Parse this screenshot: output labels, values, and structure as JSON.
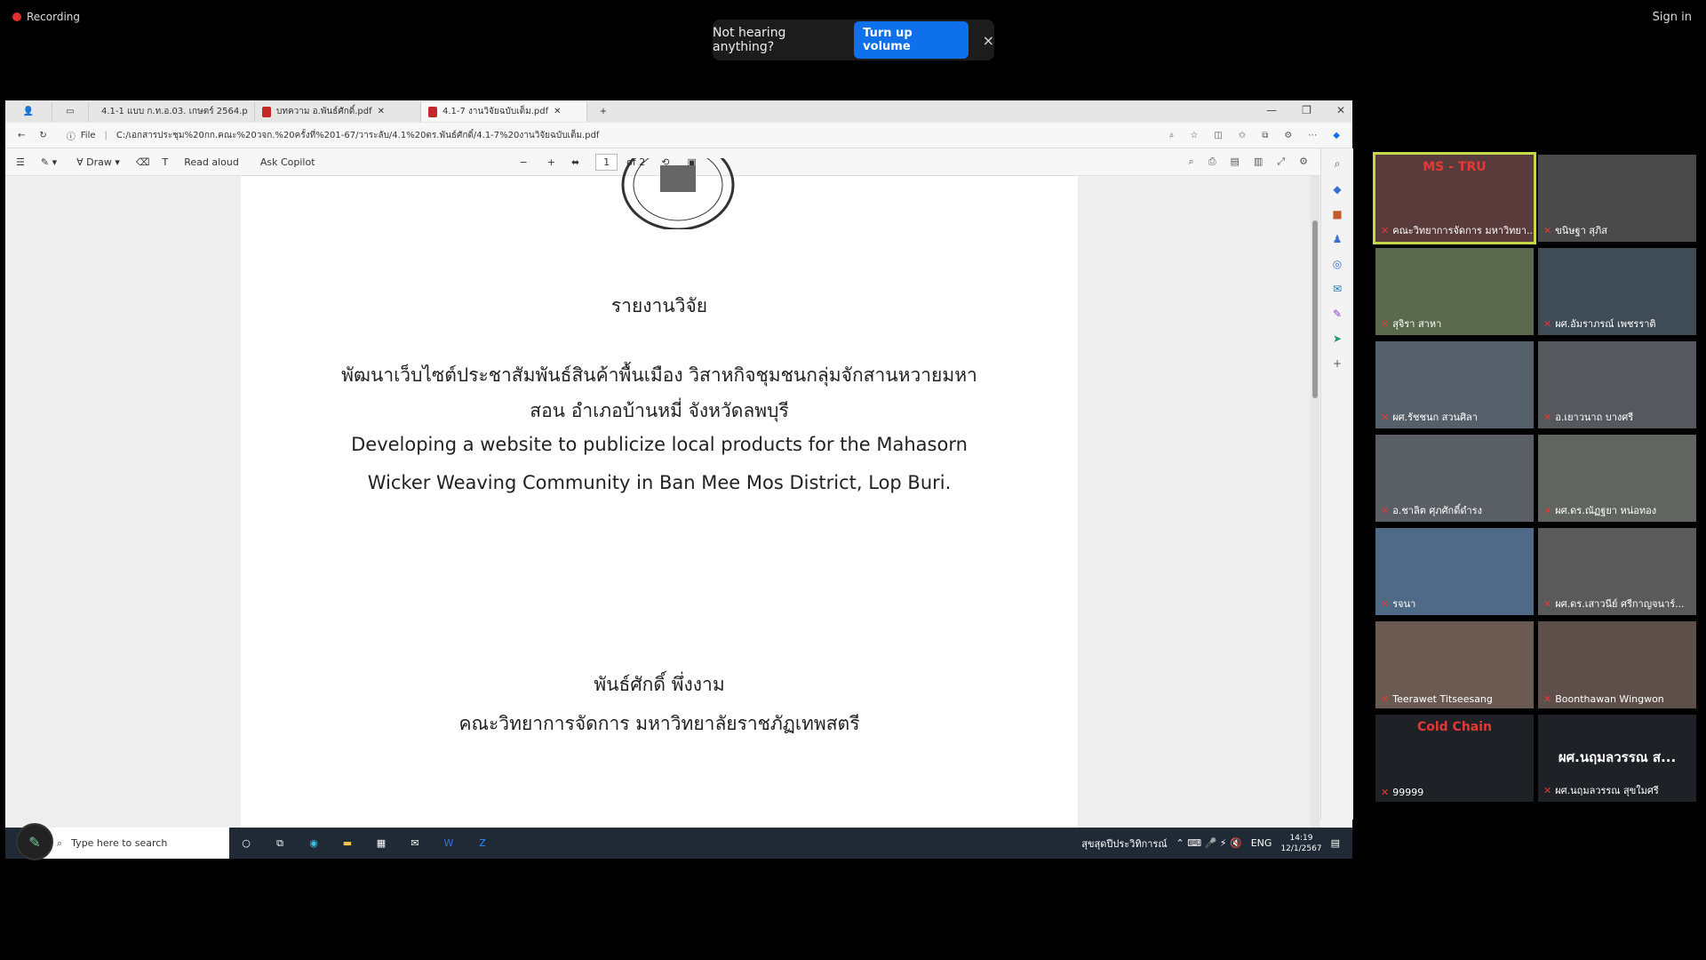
{
  "top": {
    "recording": "Recording",
    "sign_in": "Sign in",
    "notice_text": "Not hearing anything?",
    "notice_button": "Turn up volume",
    "notice_close": "×"
  },
  "browser": {
    "tabs": [
      {
        "label": "4.1-1 แบบ ก.ท.อ.03. เกษตร์ 2564.p"
      },
      {
        "label": "บทความ อ.พันธ์ศักดิ์.pdf"
      },
      {
        "label": "4.1-7 งานวิจัยฉบับเต็ม.pdf"
      }
    ],
    "address_label": "File",
    "address": "C:/เอกสารประชุม%20กก.คณะ%20วจก.%20ครั้งที่%201-67/วาระลับ/4.1%20ตร.พันธ์ศักดิ์/4.1-7%20งานวิจัยฉบับเต็ม.pdf",
    "toolbar": {
      "draw": "Draw",
      "read_aloud": "Read aloud",
      "ask_copilot": "Ask Copilot",
      "minus": "−",
      "plus": "+",
      "page_value": "1",
      "page_of": "of 2"
    }
  },
  "document": {
    "report_label": "รายงานวิจัย",
    "thai_title_line1": "พัฒนาเว็บไซต์ประชาสัมพันธ์สินค้าพื้นเมือง วิสาหกิจชุมชนกลุ่มจักสานหวายมหา",
    "thai_title_line2": "สอน อำเภอบ้านหมี่ จังหวัดลพบุรี",
    "en_title_line1": "Developing a website to publicize local products for the Mahasorn",
    "en_title_line2": "Wicker Weaving Community in Ban Mee Mos District, Lop Buri.",
    "author": "พันธ์ศักดิ์ พึ่งงาม",
    "affiliation": "คณะวิทยาการจัดการ มหาวิทยาลัยราชภัฏเทพสตรี"
  },
  "taskbar": {
    "search_placeholder": "Type here to search",
    "weather": "สุขสุดปีประวิทิการณ์",
    "lang": "ENG",
    "time": "14:19",
    "date": "12/1/2567"
  },
  "participants": [
    {
      "name": "คณะวิทยาการจัดการ มหาวิทยา...",
      "thumb_text": "MS - TRU",
      "color": "#5a3b3b"
    },
    {
      "name": "ขนิษฐา สุภิส",
      "color": "#4a4a4a"
    },
    {
      "name": "สุจิรา สาหา",
      "color": "#5b6a4d"
    },
    {
      "name": "ผศ.อัมราภรณ์ เพชรราติ",
      "color": "#3f4b55"
    },
    {
      "name": "ผศ.รัชชนก สวนศิลา",
      "color": "#56606a"
    },
    {
      "name": "อ.เยาวนาถ บางศรี",
      "color": "#55595e"
    },
    {
      "name": "อ.ชาลิต ศุภศักดิ์ดำรง",
      "color": "#5a5f66"
    },
    {
      "name": "ผศ.ดร.ณัฏฐยา หน่อทอง",
      "color": "#60655f"
    },
    {
      "name": "รจนา",
      "color": "#4f6a86"
    },
    {
      "name": "ผศ.ดร.เสาวนีย์ ศรีกาญจนาร์...",
      "color": "#5a5a5a"
    },
    {
      "name": "Teerawet Titseesang",
      "color": "#6a5a52"
    },
    {
      "name": "Boonthawan Wingwon",
      "color": "#5e4f4a"
    },
    {
      "name": "99999",
      "thumb_text": "Cold Chain",
      "color": "#1e2126"
    },
    {
      "name": "ผศ.นฤมลวรรณ สุขใมศรี",
      "big_text": "ผศ.นฤมลวรรณ ส...",
      "color": "#1e2126"
    }
  ]
}
